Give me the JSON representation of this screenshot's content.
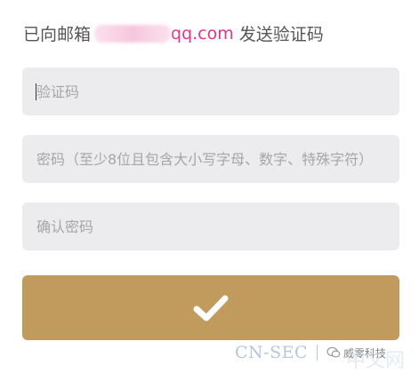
{
  "notice": {
    "prefix": "已向邮箱",
    "email_suffix": "qq.com",
    "suffix": " 发送验证码"
  },
  "fields": {
    "code_placeholder": "验证码",
    "password_placeholder": "密码（至少8位且包含大小写字母、数字、特殊字符）",
    "confirm_placeholder": "确认密码"
  },
  "submit": {
    "icon": "check-icon",
    "color": "#c19a5e"
  },
  "watermark": {
    "left": "CN-SEC",
    "brand": "威零科技",
    "right": "中文网"
  }
}
